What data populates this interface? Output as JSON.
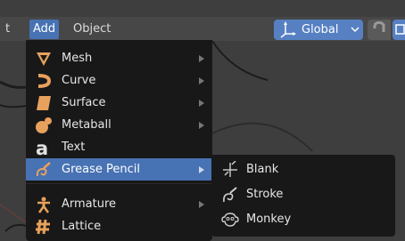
{
  "header": {
    "menus": [
      {
        "label": "t"
      },
      {
        "label": "Add"
      },
      {
        "label": "Object"
      }
    ],
    "orientation": {
      "label": "Global"
    }
  },
  "add_menu": {
    "items": [
      {
        "label": "Mesh",
        "underline": "M",
        "icon": "mesh-icon",
        "submenu": true
      },
      {
        "label": "Curve",
        "underline": "C",
        "icon": "curve-icon",
        "submenu": true
      },
      {
        "label": "Surface",
        "underline": "S",
        "icon": "surface-icon",
        "submenu": true
      },
      {
        "label": "Metaball",
        "underline": "b",
        "icon": "metaball-icon",
        "submenu": true
      },
      {
        "label": "Text",
        "underline": "T",
        "icon": "text-icon",
        "submenu": false
      },
      {
        "label": "Grease Pencil",
        "underline": "G",
        "icon": "grease-pencil-icon",
        "submenu": true,
        "highlighted": true
      },
      {
        "label": "Armature",
        "underline": "A",
        "icon": "armature-icon",
        "submenu": true
      },
      {
        "label": "Lattice",
        "underline": "L",
        "icon": "lattice-icon",
        "submenu": false
      }
    ]
  },
  "grease_pencil_submenu": {
    "items": [
      {
        "label": "Blank",
        "underline": "B",
        "icon": "blank-icon"
      },
      {
        "label": "Stroke",
        "underline": "S",
        "icon": "stroke-icon"
      },
      {
        "label": "Monkey",
        "underline": "M",
        "icon": "monkey-icon"
      }
    ]
  },
  "colors": {
    "highlight": "#4772b3",
    "menu_bg": "#181818",
    "icon_orange": "#e8a15c"
  }
}
